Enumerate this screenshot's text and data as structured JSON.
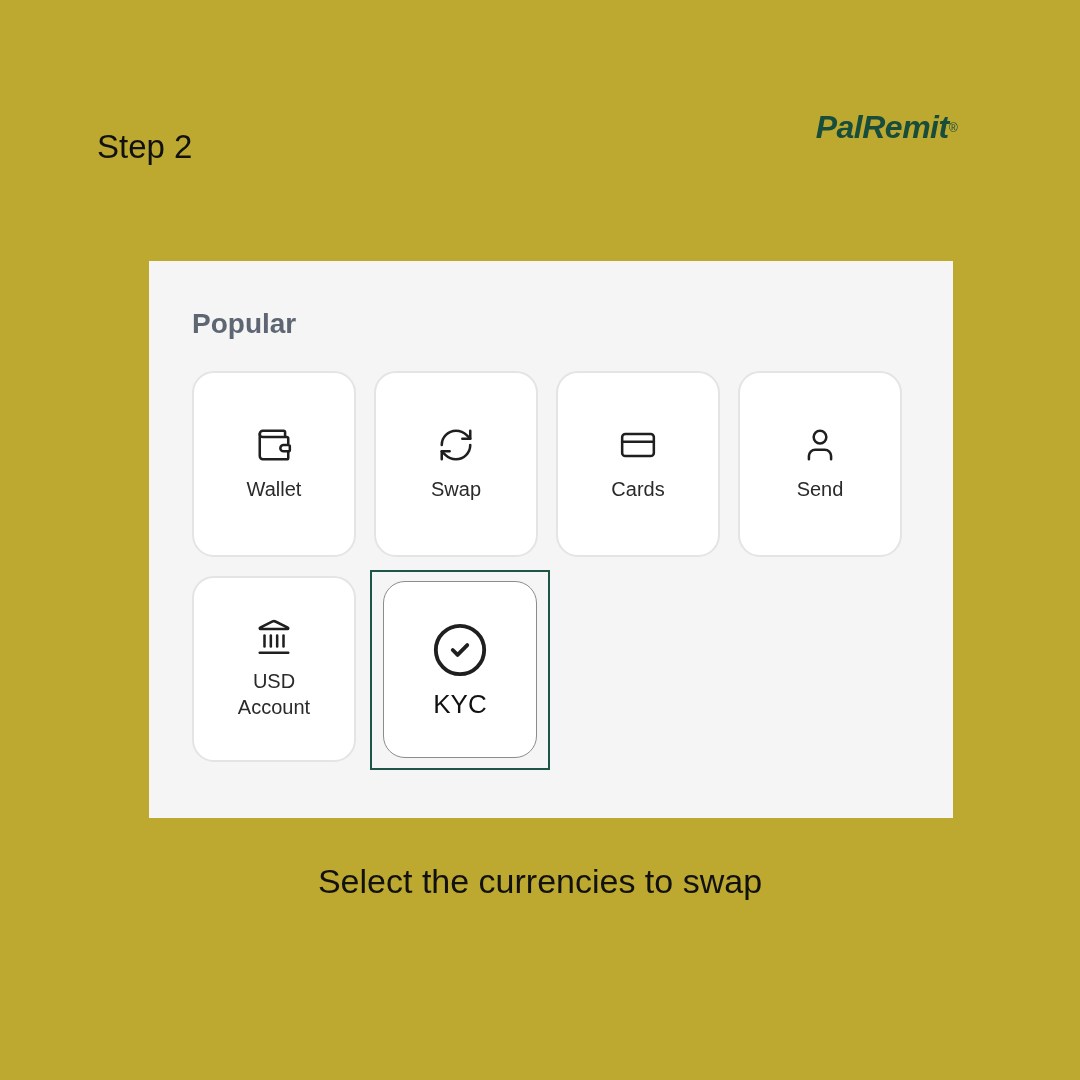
{
  "step": {
    "label": "Step 2"
  },
  "logo": {
    "text": "PalRemit$^{®}$"
  },
  "panel": {
    "title": "Popular",
    "tiles": [
      {
        "kind": "wallet",
        "label": "Wallet",
        "selected": false
      },
      {
        "kind": "swap",
        "label": "Swap",
        "selected": false
      },
      {
        "kind": "cards",
        "label": "Cards",
        "selected": false
      },
      {
        "kind": "send",
        "label": "Send",
        "selected": false
      },
      {
        "kind": "bank",
        "label": "USD Account",
        "selected": false
      },
      {
        "kind": "kyc",
        "label": "KYC",
        "selected": true
      }
    ]
  },
  "caption": "Select the currencies to swap"
}
